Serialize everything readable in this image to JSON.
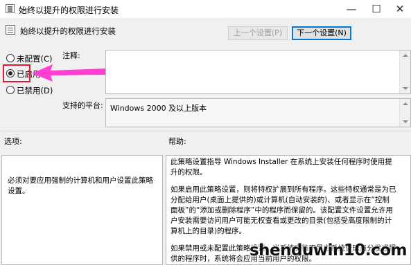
{
  "window": {
    "title": "始终以提升的权限进行安装",
    "minimize_glyph": "—",
    "maximize_glyph": "☐",
    "close_glyph": "✕"
  },
  "header": {
    "title": "始终以提升的权限进行安装",
    "prev_button": "上一个设置(P)",
    "next_button": "下一个设置(N)"
  },
  "state": {
    "options": [
      {
        "label": "未配置(C)",
        "checked": false
      },
      {
        "label": "已启用(E)",
        "checked": true
      },
      {
        "label": "已禁用(D)",
        "checked": false
      }
    ]
  },
  "comment": {
    "label": "注释:",
    "value": ""
  },
  "platform": {
    "label": "支持的平台:",
    "value": "Windows 2000 及以上版本"
  },
  "options_pane": {
    "label": "选项:",
    "text": "必须对要应用强制的计算机和用户设置此策略设置。"
  },
  "help_pane": {
    "label": "帮助:",
    "paragraphs": [
      "此策略设置指导 Windows Installer 在系统上安装任何程序时使用提升的权限。",
      "如果启用此策略设置，则将特权扩展到所有程序。这些特权通常是为已分配给用户(桌面上提供的)或计算机(自动安装的)、或者显示在“控制面板”的“添加或删除程序”中的程序而保留的。该配置文件设置允许用户安装需要访问用户可能无权查看或更改的目录(包括受高度限制的计算机上的目录)的程序。",
      "如果禁用或未配置此策略设置，当系统安装不是由系统管理员分发或提供的程序时，系统将会应用当前用户的权限。"
    ]
  },
  "watermark": "shenduwin10.com",
  "colors": {
    "highlight_box": "#e5182f",
    "arrow": "#ff3fd2",
    "primary_button_border": "#0078d7"
  }
}
